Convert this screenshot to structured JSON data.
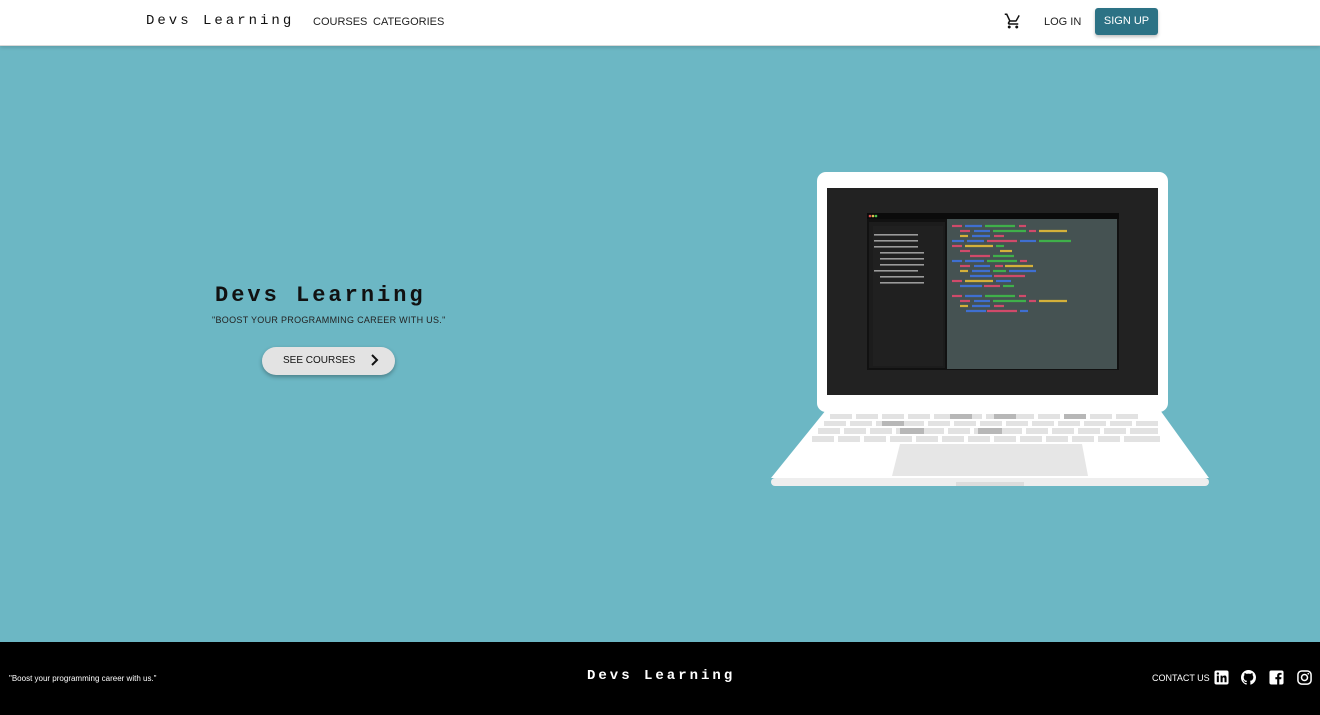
{
  "nav": {
    "brand": "Devs Learning",
    "links": [
      "COURSES",
      "CATEGORIES"
    ],
    "cart_icon": "cart-icon",
    "login": "LOG IN",
    "signup": "SIGN UP",
    "accent": "#2c7285"
  },
  "hero": {
    "title": "Devs Learning",
    "subtitle": "\"BOOST YOUR PROGRAMMING CAREER WITH US.\"",
    "cta": "SEE COURSES",
    "cta_icon": "chevron-right-icon",
    "background": "#6cb7c4",
    "illustration": "laptop-illustration"
  },
  "footer": {
    "quote": "\"Boost your programming career with us.\"",
    "brand": "Devs Learning",
    "contact": "CONTACT US",
    "social_icons": [
      "linkedin-icon",
      "github-icon",
      "facebook-icon",
      "instagram-icon"
    ]
  }
}
